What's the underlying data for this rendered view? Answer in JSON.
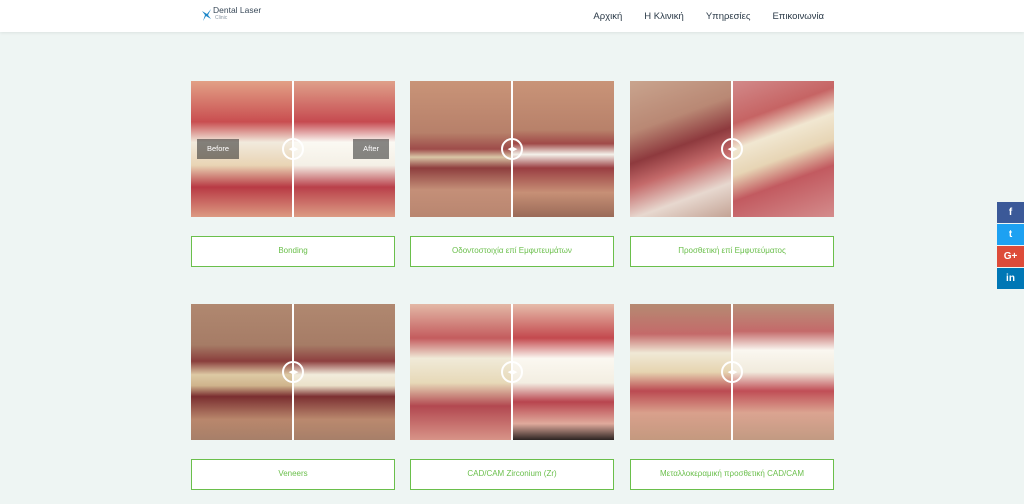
{
  "brand": {
    "name": "Dental Laser",
    "sub": "Clinic"
  },
  "nav": [
    "Αρχική",
    "Η Κλινική",
    "Υπηρεσίες",
    "Επικοινωνία"
  ],
  "slider_labels": {
    "before": "Before",
    "after": "After"
  },
  "services": [
    {
      "label": "Bonding"
    },
    {
      "label": "Οδοντοστοιχία επί Εμφυτευμάτων"
    },
    {
      "label": "Προσθετική επί Εμφυτεύματος"
    },
    {
      "label": "Veneers"
    },
    {
      "label": "CAD/CAM Zirconium (Zr)"
    },
    {
      "label": "Μεταλλοκεραμική προσθετική CAD/CAM"
    }
  ],
  "social": [
    {
      "icon": "facebook-icon",
      "glyph": "f",
      "color": "#3b5998"
    },
    {
      "icon": "twitter-icon",
      "glyph": "t",
      "color": "#1da1f2"
    },
    {
      "icon": "google-plus-icon",
      "glyph": "G+",
      "color": "#dd4b39"
    },
    {
      "icon": "linkedin-icon",
      "glyph": "in",
      "color": "#0077b5"
    }
  ],
  "colors": {
    "accent": "#6abf4b",
    "background": "#eef5f3"
  }
}
